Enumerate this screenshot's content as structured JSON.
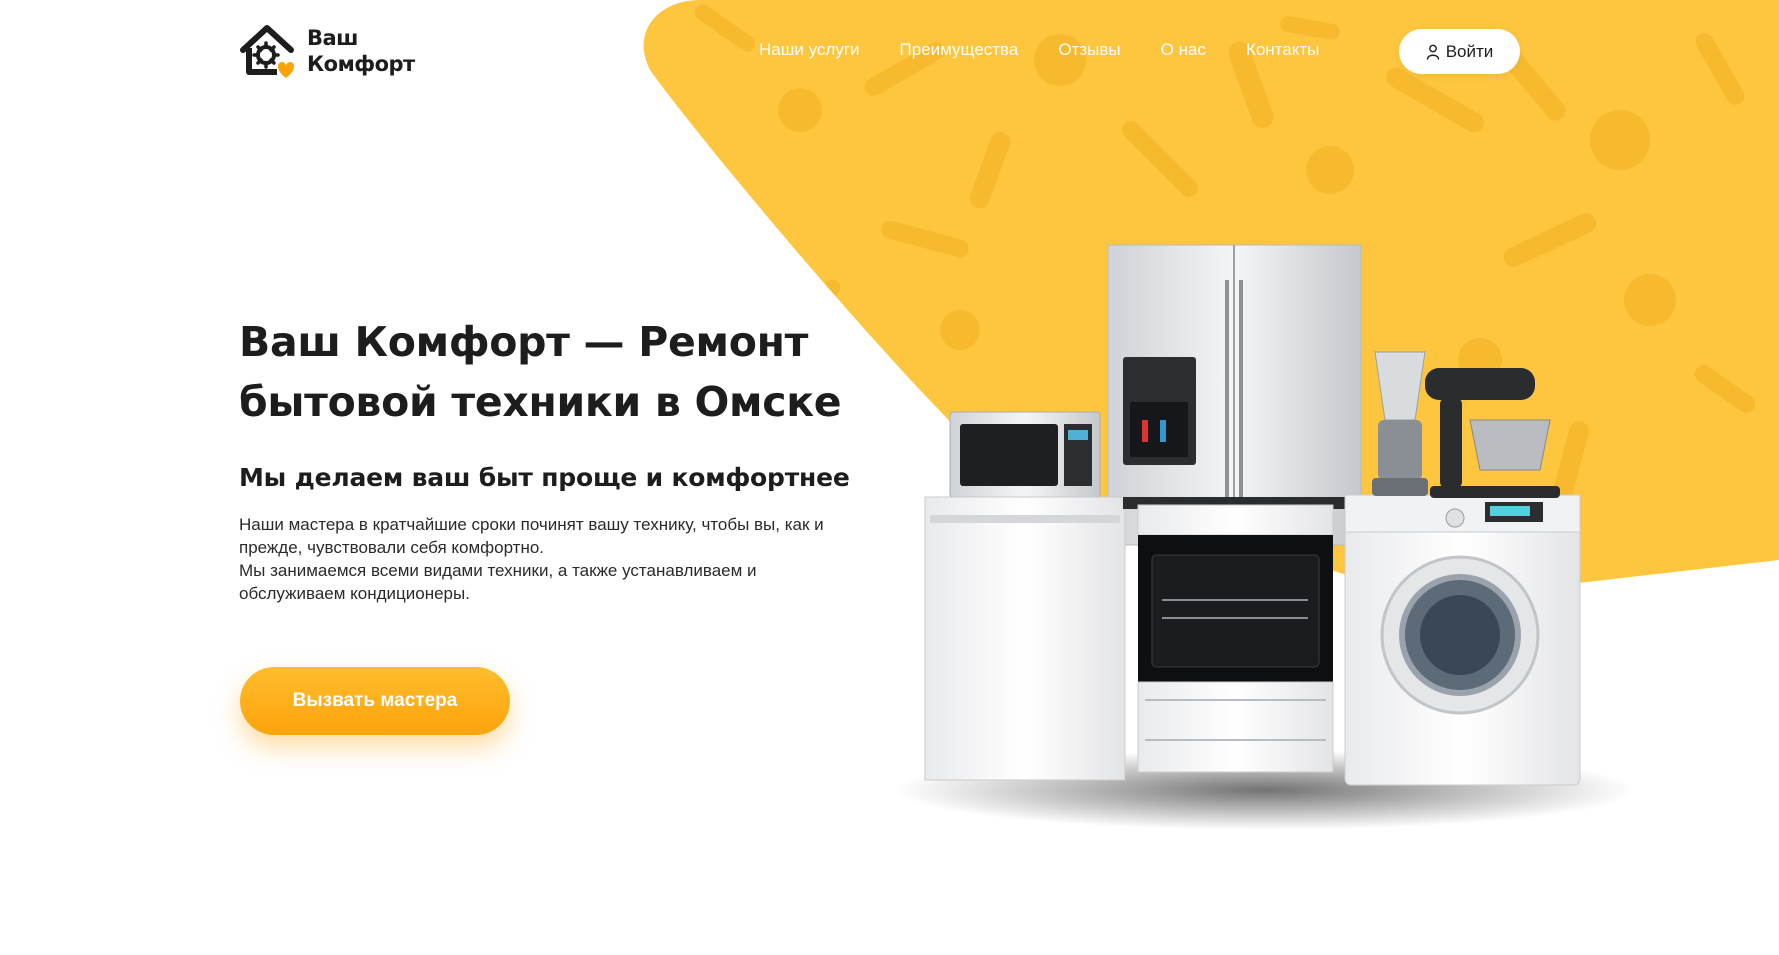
{
  "brand": {
    "name_line1": "Ваш",
    "name_line2": "Комфорт"
  },
  "nav": {
    "items": [
      {
        "label": "Наши услуги"
      },
      {
        "label": "Преимущества"
      },
      {
        "label": "Отзывы"
      },
      {
        "label": "О нас"
      },
      {
        "label": "Контакты"
      }
    ],
    "login_label": "Войти"
  },
  "hero": {
    "title_line1": "Ваш Комфорт — Ремонт",
    "title_line2": "бытовой техники в Омске",
    "subtitle": "Мы делаем ваш быт проще и комфортнее",
    "paragraph1": "Наши мастера в кратчайшие сроки починят вашу технику, чтобы вы, как и прежде, чувствовали себя комфортно.",
    "paragraph2": "Мы занимаемся всеми видами техники, а также устанавливаем и обслуживаем кондиционеры.",
    "cta_label": "Вызвать мастера"
  },
  "colors": {
    "accent_yellow": "#fec63e",
    "button_orange": "#fca30a",
    "text_dark": "#1d1d1d"
  },
  "icons": {
    "logo": "house-gear-heart-icon",
    "login": "user-icon",
    "background_pattern": "tools-pattern"
  }
}
